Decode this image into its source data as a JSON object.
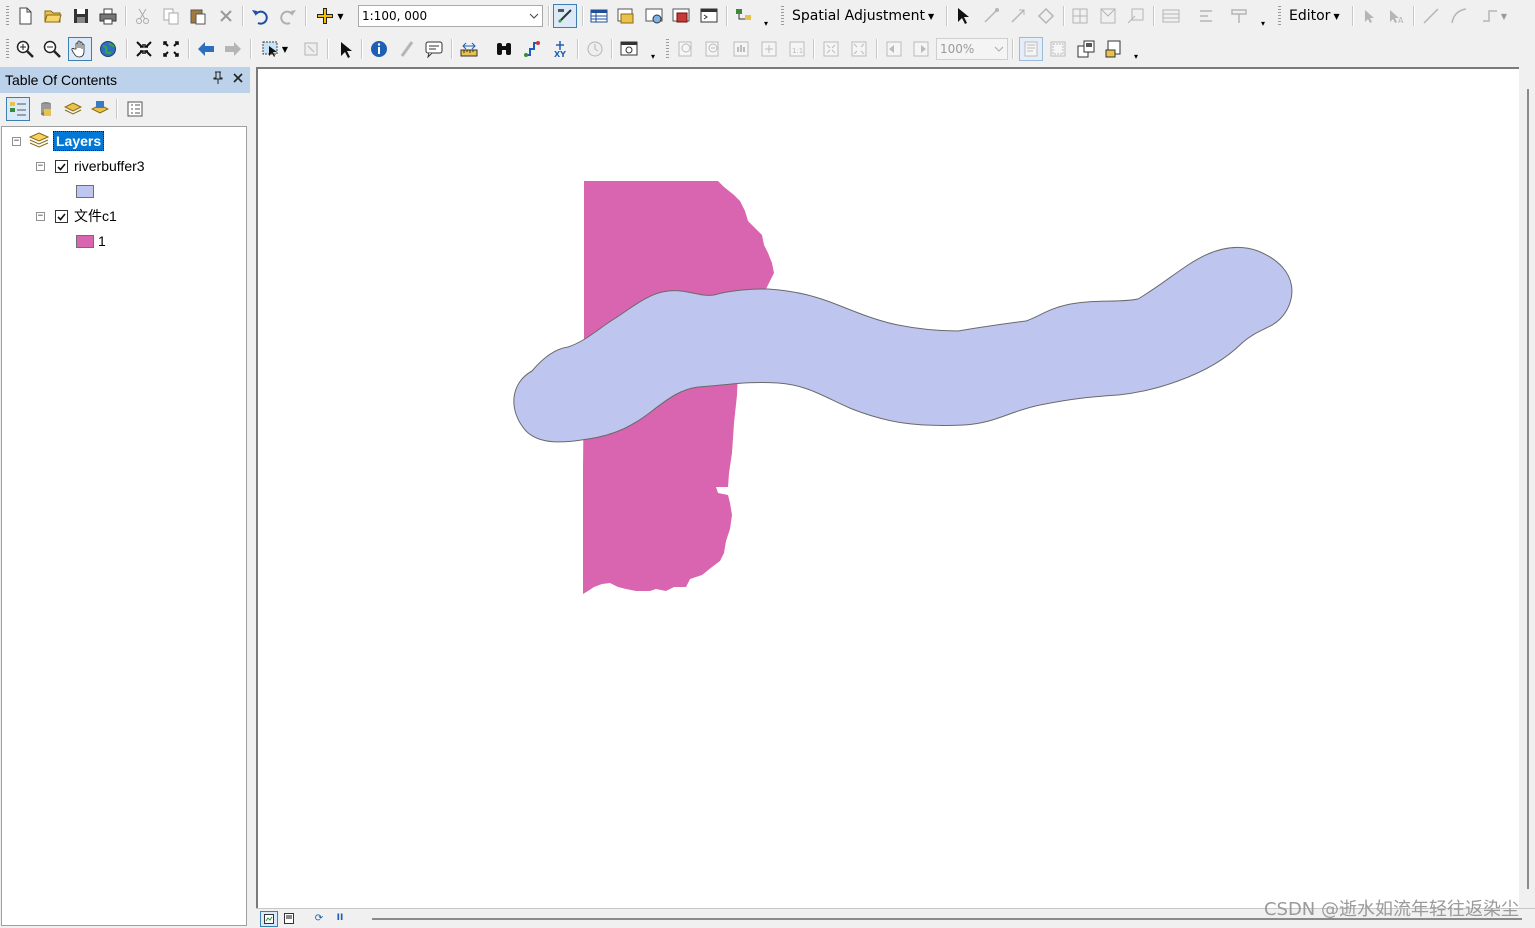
{
  "toolbar1": {
    "scale_value": "1:100, 000",
    "spatial_adjustment_label": "Spatial Adjustment",
    "editor_label": "Editor"
  },
  "toolbar2": {
    "zoom_value": "100%"
  },
  "toc": {
    "title": "Table Of Contents",
    "pin_glyph": "📌",
    "close_glyph": "✕",
    "root_label": "Layers",
    "layers": [
      {
        "name": "riverbuffer3",
        "checked": true,
        "legend": [
          {
            "label": "",
            "color": "#bec6ef"
          }
        ]
      },
      {
        "name": "文件c1",
        "checked": true,
        "legend": [
          {
            "label": "1",
            "color": "#d964b0"
          }
        ]
      }
    ]
  },
  "map": {
    "polygon_colors": {
      "pink_layer": "#d964b0",
      "buffer_layer": "#bec6ef",
      "buffer_outline": "#6a6a6a"
    }
  },
  "status": {
    "pause_glyph": "II",
    "refresh_glyph": "⟳"
  },
  "watermark": "CSDN @逝水如流年轻往返染尘",
  "icons": {
    "row1": [
      "new-document-icon",
      "open-folder-icon",
      "save-icon",
      "print-icon",
      "cut-icon",
      "copy-icon",
      "paste-icon",
      "delete-icon",
      "undo-icon",
      "redo-icon",
      "add-data-icon",
      "editor-toolbar-icon",
      "table-icon",
      "catalog-icon",
      "search-window-icon",
      "arctoolbox-icon",
      "python-window-icon",
      "model-builder-icon",
      "select-elements-icon",
      "new-displacement-link-icon",
      "modify-link-icon",
      "limit-adjustment-icon",
      "view-link-table-icon",
      "attribute-transfer-icon",
      "edit-tool-icon",
      "edit-annotation-icon",
      "straight-segment-icon",
      "end-point-arc-icon",
      "trace-icon"
    ],
    "row2": [
      "zoom-in-icon",
      "zoom-out-icon",
      "pan-icon",
      "full-extent-icon",
      "fixed-zoom-in-icon",
      "fixed-zoom-out-icon",
      "go-back-icon",
      "go-forward-icon",
      "select-features-icon",
      "clear-selection-icon",
      "select-arrow-icon",
      "identify-icon",
      "hyperlink-icon",
      "html-popup-icon",
      "measure-icon",
      "find-icon",
      "find-route-icon",
      "go-to-xy-icon",
      "time-slider-icon",
      "create-viewer-window-icon",
      "layout-zoom-in-icon",
      "layout-zoom-out-icon",
      "layout-pan-icon",
      "zoom-whole-page-icon",
      "zoom-100-icon",
      "fixed-layout-zoom-in-icon",
      "fixed-layout-zoom-out-icon",
      "go-back-extent-icon",
      "go-forward-extent-icon",
      "toggle-draft-mode-icon",
      "focus-data-frame-icon",
      "change-layout-icon",
      "data-driven-pages-icon"
    ]
  }
}
